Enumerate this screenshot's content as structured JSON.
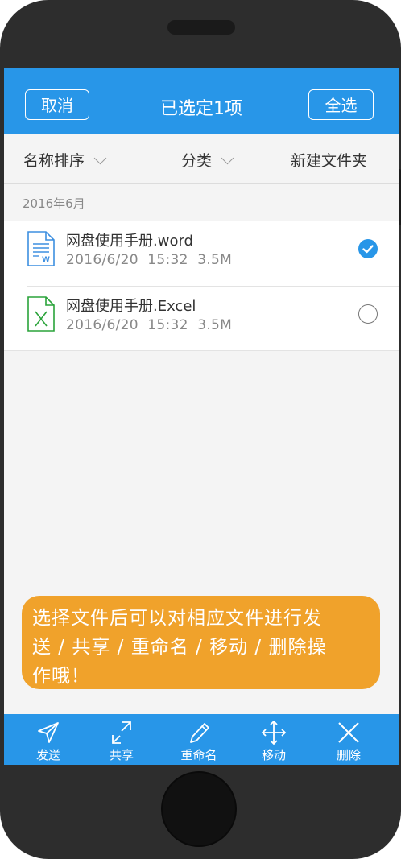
{
  "header": {
    "cancel_label": "取消",
    "title": "已选定1项",
    "select_all_label": "全选"
  },
  "filter": {
    "sort_label": "名称排序",
    "category_label": "分类",
    "new_folder_label": "新建文件夹"
  },
  "section": {
    "title": "2016年6月"
  },
  "files": [
    {
      "name": "网盘使用手册.word",
      "date": "2016/6/20",
      "time": "15:32",
      "size": "3.5M",
      "icon": "word-file-icon",
      "selected": true
    },
    {
      "name": "网盘使用手册.Excel",
      "date": "2016/6/20",
      "time": "15:32",
      "size": "3.5M",
      "icon": "excel-file-icon",
      "selected": false
    }
  ],
  "tooltip": {
    "line1": "选择文件后可以对相应文件进行发",
    "line2": "送 / 共享 / 重命名 / 移动 / 删除操",
    "line3": "作哦！"
  },
  "toolbar": [
    {
      "label": "发送",
      "icon": "send-icon"
    },
    {
      "label": "共享",
      "icon": "share-icon"
    },
    {
      "label": "重命名",
      "icon": "rename-pencil-icon"
    },
    {
      "label": "移动",
      "icon": "move-icon"
    },
    {
      "label": "删除",
      "icon": "delete-icon"
    }
  ],
  "colors": {
    "primary": "#2896e8",
    "tooltip": "#f0a22b",
    "word_icon": "#3d8fe0",
    "excel_icon": "#2aa33a"
  }
}
